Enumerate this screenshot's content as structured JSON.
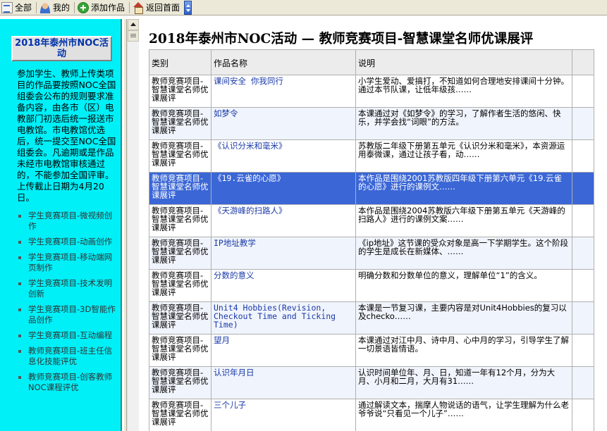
{
  "toolbar": {
    "items": [
      {
        "label": "全部",
        "icon": "list-icon"
      },
      {
        "label": "我的",
        "icon": "user-icon"
      },
      {
        "label": "添加作品",
        "icon": "add-icon"
      },
      {
        "label": "返回首面",
        "icon": "home-icon"
      }
    ]
  },
  "sidebar": {
    "title": "2018年泰州市NOC活动",
    "description": "参加学生、教师上传类项目的作品要按照NOC全国组委会公布的规则要求准备内容，由各市（区）电教部门初选后统一报送市电教馆。市电教馆优选后，统一提交至NOC全国组委会。凡逾期或是作品未经市电教馆审核通过的，不能参加全国评审。上传截止日期为4月20日。",
    "links": [
      "学生竞赛项目-微视频创作",
      "学生竞赛项目-动画创作",
      "学生竞赛项目-移动端网页制作",
      "学生竞赛项目-技术发明创新",
      "学生竞赛项目-3D智能作品创作",
      "学生竞赛项目-互动编程",
      "教师竞赛项目-班主任信息化技能评优",
      "教师竞赛项目-创客教师NOC课程评优"
    ]
  },
  "main": {
    "title": "2018年泰州市NOC活动 — 教师竞赛项目-智慧课堂名师优课展评",
    "columns": [
      "类别",
      "作品名称",
      "说明",
      ""
    ],
    "rows": [
      {
        "category": "教师竞赛项目-智慧课堂名师优课展评",
        "name": "课间安全 你我同行",
        "desc": "小学生爱动、爱搞打，不知道如何合理地安排课间十分钟。通过本节队课，让低年级孩……"
      },
      {
        "category": "教师竞赛项目-智慧课堂名师优课展评",
        "name": "如梦令",
        "desc": "本课通过对《如梦令》的学习，了解作者生活的悠闲、快乐，并学会找“词眼”的方法。"
      },
      {
        "category": "教师竞赛项目-智慧课堂名师优课展评",
        "name": "《认识分米和毫米》",
        "desc": "苏教版二年级下册第五单元《认识分米和毫米》，本资源运用泰微课，通过让孩子看，动……"
      },
      {
        "category": "教师竞赛项目-智慧课堂名师优课展评",
        "name": "《19.云雀的心愿》",
        "desc": "本作品是围绕2001苏教版四年级下册第六单元《19.云雀的心愿》进行的课例文……",
        "selected": true
      },
      {
        "category": "教师竞赛项目-智慧课堂名师优课展评",
        "name": "《天游峰的扫路人》",
        "desc": "本作品是围绕2004苏教版六年级下册第五单元《天游峰的扫路人》进行的课例文案……"
      },
      {
        "category": "教师竞赛项目-智慧课堂名师优课展评",
        "name": "IP地址教学",
        "desc": "《ip地址》这节课的受众对象是高一下学期学生。这个阶段的学生是成长在新媒体、……"
      },
      {
        "category": "教师竞赛项目-智慧课堂名师优课展评",
        "name": "分数的意义",
        "desc": "明确分数和分数单位的意义，理解单位“1”的含义。"
      },
      {
        "category": "教师竞赛项目-智慧课堂名师优课展评",
        "name": "Unit4 Hobbies(Revision, Checkout Time and Ticking Time)",
        "desc": "本课是一节复习课，主要内容是对Unit4Hobbies的复习以及checko……"
      },
      {
        "category": "教师竞赛项目-智慧课堂名师优课展评",
        "name": "望月",
        "desc": "本课通过对江中月、诗中月、心中月的学习，引导学生了解一切景语皆情语。"
      },
      {
        "category": "教师竞赛项目-智慧课堂名师优课展评",
        "name": "认识年月日",
        "desc": "认识时间单位年、月、日，知道一年有12个月，分为大月、小月和二月，大月有31……"
      },
      {
        "category": "教师竞赛项目-智慧课堂名师优课展评",
        "name": "三个儿子",
        "desc": "通过解读文本，揣摩人物说话的语气，让学生理解为什么老爷爷说“只看见一个儿子”……"
      }
    ]
  },
  "colors": {
    "sidebar_bg": "#00f0f8",
    "selected_row": "#3a66d6",
    "link_blue": "#1a3aa8",
    "title_blue": "#0033aa"
  }
}
